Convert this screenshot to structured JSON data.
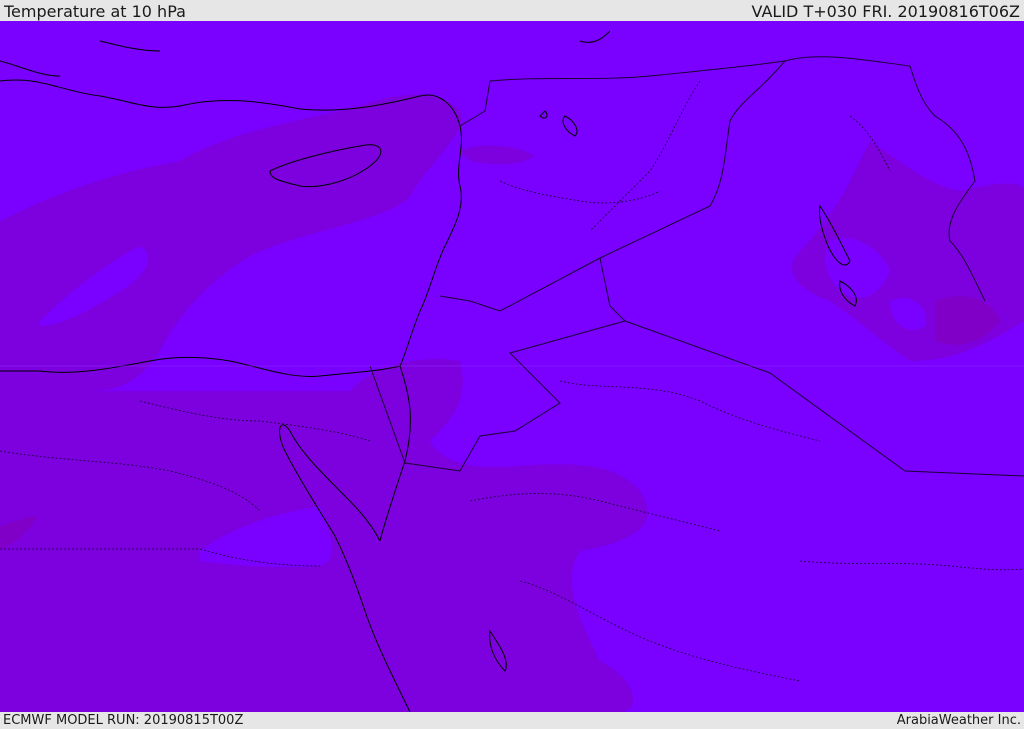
{
  "header": {
    "title": "Temperature at 10 hPa",
    "valid": "VALID T+030 FRI. 20190816T06Z"
  },
  "footer": {
    "model_run": "ECMWF MODEL RUN: 20190815T00Z",
    "credit": "ArabiaWeather Inc."
  },
  "map": {
    "colors": {
      "ocean_field": "#7a00ff",
      "warm_field": "#7d00de",
      "warmer_field": "#8000c8",
      "coastline": "#000000",
      "border": "#1a0033"
    }
  }
}
